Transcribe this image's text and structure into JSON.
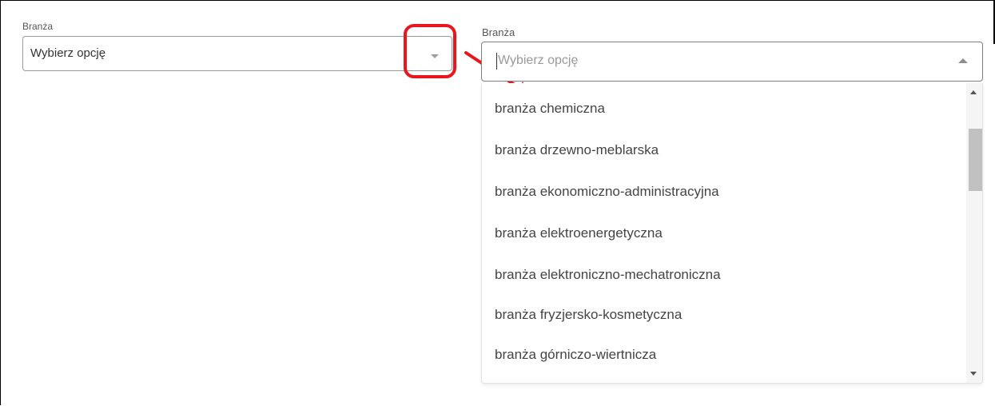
{
  "left_select": {
    "label": "Branża",
    "value": "Wybierz opcję"
  },
  "right_select": {
    "label": "Branża",
    "placeholder": "Wybierz opcję",
    "options": [
      "branża chemiczna",
      "branża drzewno-meblarska",
      "branża ekonomiczno-administracyjna",
      "branża elektroenergetyczna",
      "branża elektroniczno-mechatroniczna",
      "branża fryzjersko-kosmetyczna",
      "branża górniczo-wiertnicza"
    ]
  },
  "colors": {
    "annotation": "#e8171b",
    "border": "#9a9a9a",
    "scrollbar_thumb": "#c1c1c1"
  },
  "icons": {
    "left_caret": "chevron-down-icon",
    "right_caret": "chevron-up-icon",
    "scroll_up": "scroll-up-icon",
    "scroll_down": "scroll-down-icon",
    "annotation_arrow": "arrow-icon"
  }
}
